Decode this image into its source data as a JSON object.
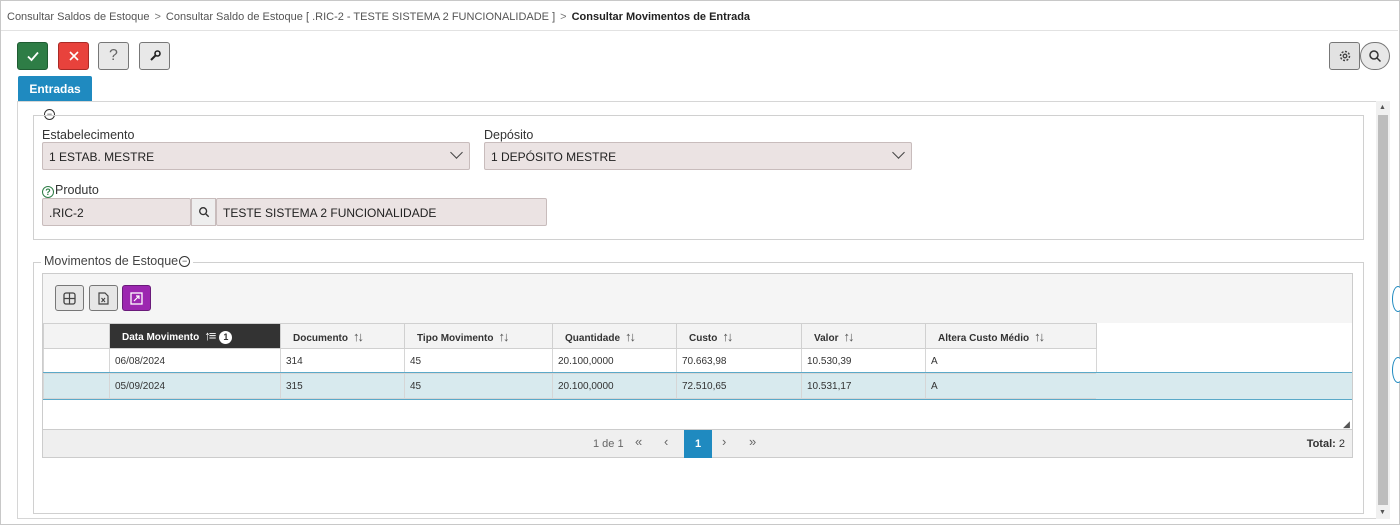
{
  "breadcrumb": {
    "item1": "Consultar Saldos de Estoque",
    "item2": "Consultar Saldo de Estoque [ .RIC-2 - TESTE SISTEMA 2 FUNCIONALIDADE ]",
    "current": "Consultar Movimentos de Entrada",
    "separator": ">"
  },
  "toolbar": {
    "confirm_icon": "check-icon",
    "cancel_icon": "close-icon",
    "help_label": "?",
    "tool_icon": "wrench-icon",
    "settings_icon": "gear-icon",
    "search_icon": "search-icon"
  },
  "tab": {
    "label": "Entradas"
  },
  "filters": {
    "estabelecimento_label": "Estabelecimento",
    "estabelecimento_value": "1 ESTAB. MESTRE",
    "deposito_label": "Depósito",
    "deposito_value": "1 DEPÓSITO MESTRE",
    "produto_label": "Produto",
    "produto_code": ".RIC-2",
    "produto_desc": "TESTE SISTEMA 2 FUNCIONALIDADE"
  },
  "movimentos": {
    "title": "Movimentos de Estoque",
    "columns": [
      "Data Movimento",
      "Documento",
      "Tipo Movimento",
      "Quantidade",
      "Custo",
      "Valor",
      "Altera Custo Médio"
    ],
    "sort_badge": "1",
    "rows": [
      [
        "06/08/2024",
        "314",
        "45",
        "20.100,0000",
        "70.663,98",
        "10.530,39",
        "A"
      ],
      [
        "05/09/2024",
        "315",
        "45",
        "20.100,0000",
        "72.510,65",
        "10.531,17",
        "A"
      ]
    ]
  },
  "pager": {
    "info": "1 de 1",
    "first": "«",
    "prev": "‹",
    "current": "1",
    "next": "›",
    "last": "»",
    "total_label": "Total:",
    "total_value": "2"
  },
  "colors": {
    "accent": "#1f8ac0",
    "confirm": "#2e7d46",
    "cancel": "#e8423c",
    "export_active": "#9c27b0",
    "selected_row": "#d8eaee"
  }
}
